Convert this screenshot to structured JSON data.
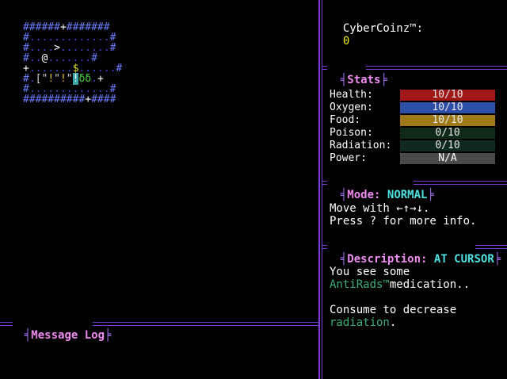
{
  "currency": {
    "label": "CyberCoinz™:",
    "value": "0"
  },
  "map": {
    "rows": [
      [
        [
          "######",
          "wall"
        ],
        [
          "+",
          "door"
        ],
        [
          "#######",
          "wall"
        ]
      ],
      [
        [
          "#",
          "wall"
        ],
        [
          ".............",
          "floor"
        ],
        [
          "#",
          "wall"
        ]
      ],
      [
        [
          "#",
          "wall"
        ],
        [
          "....",
          "floor"
        ],
        [
          ">",
          "stairs"
        ],
        [
          "........",
          "floor"
        ],
        [
          "#",
          "wall"
        ]
      ],
      [
        [
          "#",
          "wall"
        ],
        [
          "..",
          "floor"
        ],
        [
          "@",
          "player"
        ],
        [
          ".......",
          "floor"
        ],
        [
          "#",
          "wall"
        ]
      ],
      [
        [
          "+",
          "door"
        ],
        [
          ".......",
          "floor"
        ],
        [
          "$",
          "coin"
        ],
        [
          "......",
          "floor"
        ],
        [
          "#",
          "wall"
        ]
      ],
      [
        [
          "#",
          "wall"
        ],
        [
          ".",
          "floor"
        ],
        [
          "[",
          "item"
        ],
        [
          "\"",
          "item"
        ],
        [
          "!",
          "yellow"
        ],
        [
          "\"",
          "item"
        ],
        [
          "!",
          "yellow"
        ],
        [
          "\"",
          "item"
        ],
        [
          "!",
          "cursor"
        ],
        [
          "δδ",
          "green"
        ],
        [
          ".",
          "floor"
        ],
        [
          "+",
          "door"
        ]
      ],
      [
        [
          "#",
          "wall"
        ],
        [
          ".............",
          "floor"
        ],
        [
          "#",
          "wall"
        ]
      ],
      [
        [
          "##########",
          "wall"
        ],
        [
          "+",
          "door"
        ],
        [
          "####",
          "wall"
        ]
      ]
    ]
  },
  "stats": {
    "title": "Stats",
    "items": [
      {
        "label": "Health:",
        "value": "10/10",
        "color": "#a01818"
      },
      {
        "label": "Oxygen:",
        "value": "10/10",
        "color": "#2e4fa8"
      },
      {
        "label": "Food:",
        "value": "10/10",
        "color": "#a07a18"
      },
      {
        "label": "Poison:",
        "value": "0/10",
        "color": "#0f2a18"
      },
      {
        "label": "Radiation:",
        "value": "0/10",
        "color": "#0f2a20"
      },
      {
        "label": "Power:",
        "value": "N/A",
        "color": "#4a4a4a"
      }
    ]
  },
  "mode": {
    "title": "Mode:",
    "value": "NORMAL",
    "line1": "Move with ←↑→↓.",
    "line2": "Press ? for more info."
  },
  "description": {
    "title": "Description:",
    "value": "AT CURSOR",
    "line1": "You see some",
    "item_name": "AntiRads™",
    "item_suffix": "medication..",
    "line3": "Consume to decrease",
    "effect": "radiation",
    "effect_suffix": "."
  },
  "message_log": {
    "title": "Message Log"
  },
  "colors": {
    "frame": "#7b3bd6",
    "heading": "#f08cf0",
    "value": "#50e0e0"
  }
}
